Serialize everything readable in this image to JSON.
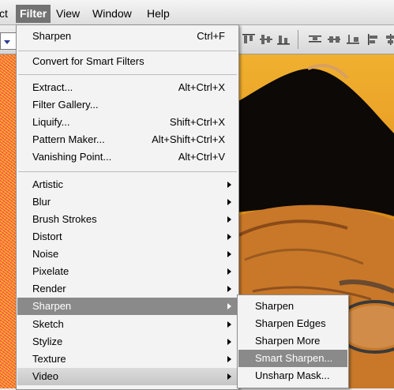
{
  "menubar": {
    "items": [
      {
        "label": "ct"
      },
      {
        "label": "Filter"
      },
      {
        "label": "View"
      },
      {
        "label": "Window"
      },
      {
        "label": "Help"
      }
    ]
  },
  "filter_menu": {
    "last_filter": {
      "label": "Sharpen",
      "shortcut": "Ctrl+F"
    },
    "convert": {
      "label": "Convert for Smart Filters"
    },
    "extract": {
      "label": "Extract...",
      "shortcut": "Alt+Ctrl+X"
    },
    "gallery": {
      "label": "Filter Gallery..."
    },
    "liquify": {
      "label": "Liquify...",
      "shortcut": "Shift+Ctrl+X"
    },
    "pattern": {
      "label": "Pattern Maker...",
      "shortcut": "Alt+Shift+Ctrl+X"
    },
    "vanishing": {
      "label": "Vanishing Point...",
      "shortcut": "Alt+Ctrl+V"
    },
    "groups": [
      {
        "label": "Artistic"
      },
      {
        "label": "Blur"
      },
      {
        "label": "Brush Strokes"
      },
      {
        "label": "Distort"
      },
      {
        "label": "Noise"
      },
      {
        "label": "Pixelate"
      },
      {
        "label": "Render"
      },
      {
        "label": "Sharpen"
      },
      {
        "label": "Sketch"
      },
      {
        "label": "Stylize"
      },
      {
        "label": "Texture"
      },
      {
        "label": "Video"
      }
    ]
  },
  "sharpen_submenu": {
    "items": [
      {
        "label": "Sharpen"
      },
      {
        "label": "Sharpen Edges"
      },
      {
        "label": "Sharpen More"
      },
      {
        "label": "Smart Sharpen..."
      },
      {
        "label": "Unsharp Mask..."
      }
    ]
  },
  "colors": {
    "menu_highlight": "#8a8a8a",
    "menubar_active": "#737373"
  }
}
